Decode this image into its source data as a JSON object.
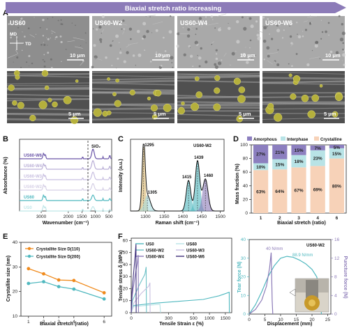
{
  "banner": {
    "title": "Biaxial stretch ratio increasing",
    "arrow_color": "#8c7bb8"
  },
  "panel_a": {
    "label": "A",
    "sem_labels": [
      "US60",
      "US60-W2",
      "US60-W4",
      "US60-W6"
    ],
    "scale_top": "10 μm",
    "scale_bottom": "5 μm",
    "axis_md": "MD",
    "axis_td": "TD"
  },
  "panel_b": {
    "label": "B",
    "ylabel": "Absorbance (%)",
    "xlabel": "Wavenumber (cm⁻¹)",
    "xticks": [
      "3000",
      "2000",
      "1500",
      "1000",
      "500"
    ],
    "sio2_label": "SiO₂",
    "traces": [
      {
        "name": "US60-W6",
        "color": "#6a55a8"
      },
      {
        "name": "US60-W4",
        "color": "#b9aed6"
      },
      {
        "name": "US60-W3",
        "color": "#c8bfe0"
      },
      {
        "name": "US60-W2",
        "color": "#d6d0e6"
      },
      {
        "name": "US60",
        "color": "#4fb8bf"
      },
      {
        "name": "US0",
        "color": "#bfe6e8"
      }
    ]
  },
  "panel_c": {
    "label": "C",
    "title": "US60-W2",
    "ylabel": "Intensity (a.u.)",
    "xlabel": "Raman shift (cm⁻¹)",
    "xticks": [
      "1300",
      "1350",
      "1400",
      "1450",
      "1500"
    ],
    "peaks": [
      {
        "label": "1295",
        "x": 1295,
        "color": "#d8b56a"
      },
      {
        "label": "1305",
        "x": 1305,
        "color": "#a8dcdf"
      },
      {
        "label": "1415",
        "x": 1415,
        "color": "#4fb8bf"
      },
      {
        "label": "1439",
        "x": 1439,
        "color": "#4fb8bf"
      },
      {
        "label": "1460",
        "x": 1460,
        "color": "#8c7bb8"
      }
    ]
  },
  "panel_d": {
    "label": "D",
    "legend": [
      "Amorphous",
      "Interphase",
      "Crystalline"
    ],
    "colors": {
      "amorphous": "#8c7fbf",
      "interphase": "#b8e3e6",
      "crystalline": "#f7d2b8"
    },
    "ylabel": "Mass fraction (%)",
    "xlabel": "Biaxial stretch (ratio)"
  },
  "panel_e": {
    "label": "E",
    "ylabel": "Crystallite size (nm)",
    "xlabel": "Biaxial stretch (ratio)",
    "legend": [
      "Crystallite Size D(110)",
      "Crystallite Size D(200)"
    ]
  },
  "panel_f": {
    "label": "F",
    "ylabel": "Tensile stress δ (MPa)",
    "xlabel": "Tensile Strain ε (%)",
    "legend": [
      "US0",
      "US60",
      "US60-W2",
      "US60-W3",
      "US60-W4",
      "US60-W6"
    ],
    "colors": [
      "#4fb8bf",
      "#b8e3e6",
      "#6fc2c7",
      "#c8bfe0",
      "#8c7bb8",
      "#3d2e7a"
    ],
    "xticks": [
      "0",
      "300",
      "500",
      "1000",
      "1500"
    ],
    "yticks": [
      "0",
      "10",
      "20",
      "30",
      "40",
      "50",
      "60"
    ]
  },
  "panel_g": {
    "title": "US60-W2",
    "ylabel_left": "Tear force (N)",
    "ylabel_right": "Puncture force (N)",
    "xlabel": "Displacement (mm)",
    "annot_purple": "40 N/mm",
    "annot_teal": "88.9 N/mm",
    "xticks": [
      "0",
      "5",
      "10",
      "15",
      "20",
      "25"
    ],
    "yticks_left": [
      "0",
      "10",
      "20",
      "30",
      "40"
    ],
    "yticks_right": [
      "0",
      "4",
      "8",
      "12",
      "16"
    ]
  },
  "chart_data": [
    {
      "type": "bar",
      "panel": "D",
      "categories": [
        "1",
        "2",
        "3",
        "4",
        "6"
      ],
      "series": [
        {
          "name": "Crystalline",
          "values": [
            63,
            64,
            67,
            69,
            80
          ]
        },
        {
          "name": "Interphase",
          "values": [
            10,
            15,
            18,
            23,
            15
          ]
        },
        {
          "name": "Amorphous",
          "values": [
            27,
            21,
            15,
            7,
            5
          ]
        }
      ],
      "stacked": true,
      "ylim": [
        0,
        100
      ],
      "yticks": [
        0,
        20,
        40,
        60,
        80,
        100
      ],
      "labels": {
        "Crystalline": [
          "63%",
          "64%",
          "67%",
          "69%",
          "80%"
        ],
        "Interphase": [
          "10%",
          "15%",
          "18%",
          "23%",
          "15%"
        ],
        "Amorphous": [
          "27%",
          "21%",
          "15%",
          "7%",
          "5%"
        ]
      }
    },
    {
      "type": "line",
      "panel": "E",
      "x": [
        1,
        2,
        3,
        4,
        6
      ],
      "x_labels": [
        "1",
        "2",
        "3",
        "4",
        "6"
      ],
      "series": [
        {
          "name": "Crystallite Size D(110)",
          "color": "#f08a1c",
          "values": [
            29.3,
            27.2,
            24.7,
            24.5,
            19.5
          ]
        },
        {
          "name": "Crystallite Size D(200)",
          "color": "#4fb8bf",
          "values": [
            23.3,
            24.0,
            22.0,
            21.0,
            17.0
          ]
        }
      ],
      "ylim": [
        10,
        40
      ],
      "yticks": [
        10,
        20,
        30,
        40
      ]
    }
  ]
}
